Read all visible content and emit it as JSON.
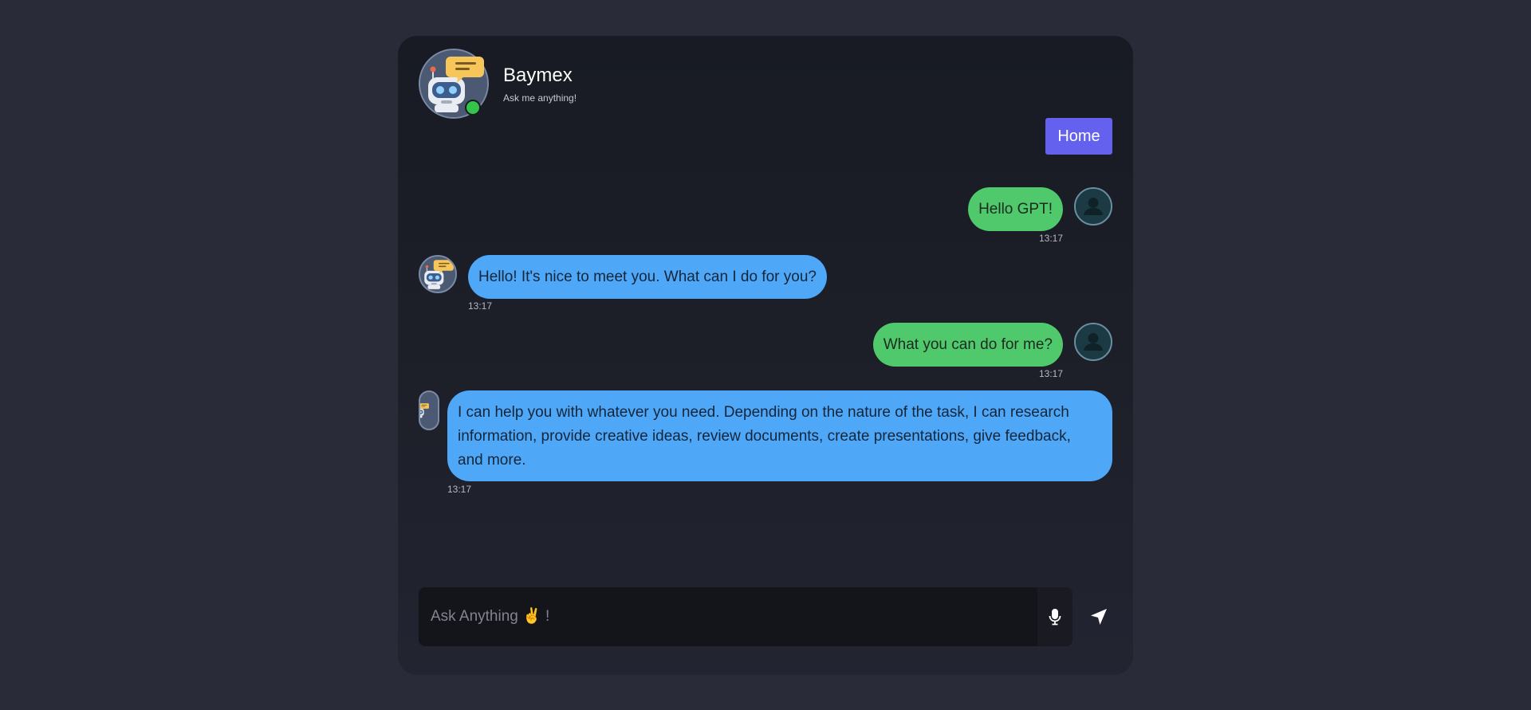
{
  "header": {
    "bot_name": "Baymex",
    "subtitle": "Ask me anything!",
    "home_label": "Home",
    "status": "online",
    "avatar_icon": "robot-chat-icon"
  },
  "messages": [
    {
      "sender": "user",
      "text": "Hello GPT!",
      "time": "13:17"
    },
    {
      "sender": "bot",
      "text": "Hello! It's nice to meet you. What can I do for you?",
      "time": "13:17"
    },
    {
      "sender": "user",
      "text": "What you can do for me?",
      "time": "13:17"
    },
    {
      "sender": "bot",
      "text_lines": [
        "I can help you with whatever you need. Depending on the nature of the task, I can research",
        "information, provide creative ideas, review documents, create presentations, give feedback,",
        "and more."
      ],
      "time": "13:17"
    }
  ],
  "composer": {
    "placeholder": "Ask Anything ✌️ !",
    "mic_icon": "microphone-icon",
    "send_icon": "send-icon"
  },
  "colors": {
    "page_bg": "#2a2b38",
    "card_bg": "#1b1d26",
    "user_bubble": "#4fc96b",
    "bot_bubble": "#4fa7f8",
    "home_button": "#6461ee",
    "online": "#33c44a"
  }
}
